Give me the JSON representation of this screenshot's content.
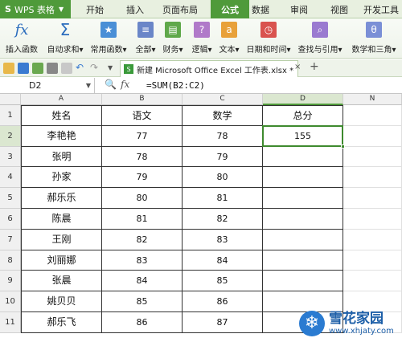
{
  "menubar": {
    "app_label": "WPS 表格",
    "items": [
      {
        "label": "开始"
      },
      {
        "label": "插入"
      },
      {
        "label": "页面布局"
      },
      {
        "label": "公式"
      },
      {
        "label": "数据"
      },
      {
        "label": "审阅"
      },
      {
        "label": "视图"
      },
      {
        "label": "开发工具"
      }
    ],
    "active_index": 3
  },
  "ribbon": {
    "buttons": [
      {
        "label": "插入函数",
        "icon": "fx-icon"
      },
      {
        "label": "自动求和",
        "icon": "sigma-icon"
      },
      {
        "label": "常用函数",
        "icon": "star-icon"
      },
      {
        "label": "全部",
        "icon": "list-icon"
      },
      {
        "label": "财务",
        "icon": "finance-icon"
      },
      {
        "label": "逻辑",
        "icon": "logic-icon"
      },
      {
        "label": "文本",
        "icon": "text-icon"
      },
      {
        "label": "日期和时间",
        "icon": "clock-icon"
      },
      {
        "label": "查找与引用",
        "icon": "search-icon"
      },
      {
        "label": "数学和三角",
        "icon": "theta-icon"
      }
    ]
  },
  "document_tab": {
    "title": "新建 Microsoft Office Excel 工作表.xlsx *",
    "close": "×",
    "add": "+"
  },
  "formula_bar": {
    "name_box": "D2",
    "fx": "fx",
    "formula": "=SUM(B2:C2)"
  },
  "sheet": {
    "columns": [
      "A",
      "B",
      "C",
      "D",
      "N"
    ],
    "selected_column": "D",
    "selected_row": "2",
    "header_row": [
      "姓名",
      "语文",
      "数学",
      "总分"
    ],
    "rows": [
      {
        "num": "2",
        "name": "李艳艳",
        "chinese": "77",
        "math": "78",
        "total": "155"
      },
      {
        "num": "3",
        "name": "张明",
        "chinese": "78",
        "math": "79",
        "total": ""
      },
      {
        "num": "4",
        "name": "孙家",
        "chinese": "79",
        "math": "80",
        "total": ""
      },
      {
        "num": "5",
        "name": "郝乐乐",
        "chinese": "80",
        "math": "81",
        "total": ""
      },
      {
        "num": "6",
        "name": "陈晨",
        "chinese": "81",
        "math": "82",
        "total": ""
      },
      {
        "num": "7",
        "name": "王刚",
        "chinese": "82",
        "math": "83",
        "total": ""
      },
      {
        "num": "8",
        "name": "刘丽娜",
        "chinese": "83",
        "math": "84",
        "total": ""
      },
      {
        "num": "9",
        "name": "张晨",
        "chinese": "84",
        "math": "85",
        "total": ""
      },
      {
        "num": "10",
        "name": "姚贝贝",
        "chinese": "85",
        "math": "86",
        "total": ""
      },
      {
        "num": "11",
        "name": "郝乐飞",
        "chinese": "86",
        "math": "87",
        "total": ""
      }
    ],
    "header_row_num": "1"
  },
  "watermark": {
    "title": "雪花家园",
    "url": "www.xhjaty.com"
  },
  "colors": {
    "accent": "#4f9a3a",
    "selection": "#3e8a2e"
  }
}
